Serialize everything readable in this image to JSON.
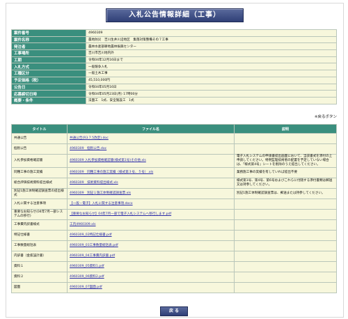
{
  "page": {
    "title": "入札公告情報詳細（工事）",
    "note": "※戻るボタン",
    "back_label": "戻 る"
  },
  "info_rows": [
    {
      "label": "案件番号",
      "value": "4960309"
    },
    {
      "label": "案件名称",
      "value": "農地防災　吉川生井川沿地区　集落対策整備その７工事"
    },
    {
      "label": "発注者",
      "value": "農林水産部耕地農林振興センター"
    },
    {
      "label": "工事場所",
      "value": "吉川市吉川地内外"
    },
    {
      "label": "工期",
      "value": "令和04年12月16日まで"
    },
    {
      "label": "入札方式",
      "value": "一般競争入札"
    },
    {
      "label": "工種区分",
      "value": "一般土木工事"
    },
    {
      "label": "予定価格（税）",
      "value": "45,510,000円"
    },
    {
      "label": "公告日",
      "value": "令和04年05月16日"
    },
    {
      "label": "応募締切日時",
      "value": "令和04年05月23日(月) 17時00分"
    },
    {
      "label": "概要・条件",
      "value": "法面工　1式、安全施設工　1式"
    }
  ],
  "files": {
    "headers": [
      "タイトル",
      "ファイル名",
      "説明"
    ],
    "rows": [
      {
        "title": "共通公告",
        "file": "共通公告(R3.7.5改定).doc",
        "desc": ""
      },
      {
        "title": "個別公告",
        "file": "4960309　個別公告.doc",
        "desc": ""
      },
      {
        "title": "入札参加資格確認書",
        "file": "4960309 入札参加資格確認書(様式第1号)その他.xls",
        "desc": "電子入札システムの申請書提出画面において、当該書式を添付の上申請してください。特例監理技術者の配置を予定していない場合は、「様式第4号」シートを削除のうえ提出してください。"
      },
      {
        "title": "同種工事の施工実績",
        "file": "4960309　同種工事の施工実績（様式第３号、５号）.xls",
        "desc": "業務施工事の実績を有していれば提出不要"
      },
      {
        "title": "総合評価技術資料提出様式",
        "file": "4960309　技術資料提出様式.xls",
        "desc": "様式第1号、第4号、第6号およびこれらに付随する添付書類は郵送又は持参してください。"
      },
      {
        "title": "別記1施工体制確認調査票の提出様式",
        "file": "4960309　別記１施工体制確認調査票.xls",
        "desc": "別記1施工体制確認調査票は、郵送または持参してください。"
      },
      {
        "title": "入札に関する注意事項",
        "file": "【一般・電子】入札に関する注意事項.docx",
        "desc": ""
      },
      {
        "title": "重要なお知らせ(04年7月一部システムの移行)",
        "file": "【重要なお知らせ】04年7月一部で電子入札システムへ移行します.pdf",
        "desc": ""
      },
      {
        "title": "工事費内訳書様式",
        "file": "工内4960309.xls",
        "desc": ""
      },
      {
        "title": "特記仕様書",
        "file": "4960309_02特記仕様書.pdf",
        "desc": ""
      },
      {
        "title": "工事数量総括表",
        "file": "4960309_03工事数量総括表.pdf",
        "desc": ""
      },
      {
        "title": "内訳書（金抜設計書）",
        "file": "4960309_04工事費内訳書.pdf",
        "desc": ""
      },
      {
        "title": "資料１",
        "file": "4960309_05資料1.pdf",
        "desc": ""
      },
      {
        "title": "資料２",
        "file": "4960309_06資料2.pdf",
        "desc": ""
      },
      {
        "title": "図面",
        "file": "4960309_07図面.pdf",
        "desc": ""
      }
    ]
  },
  "colors": {
    "header_bg": "#3a8f7e",
    "cell_bg": "#f7f7dc",
    "title_bg": "#2f3f77"
  }
}
